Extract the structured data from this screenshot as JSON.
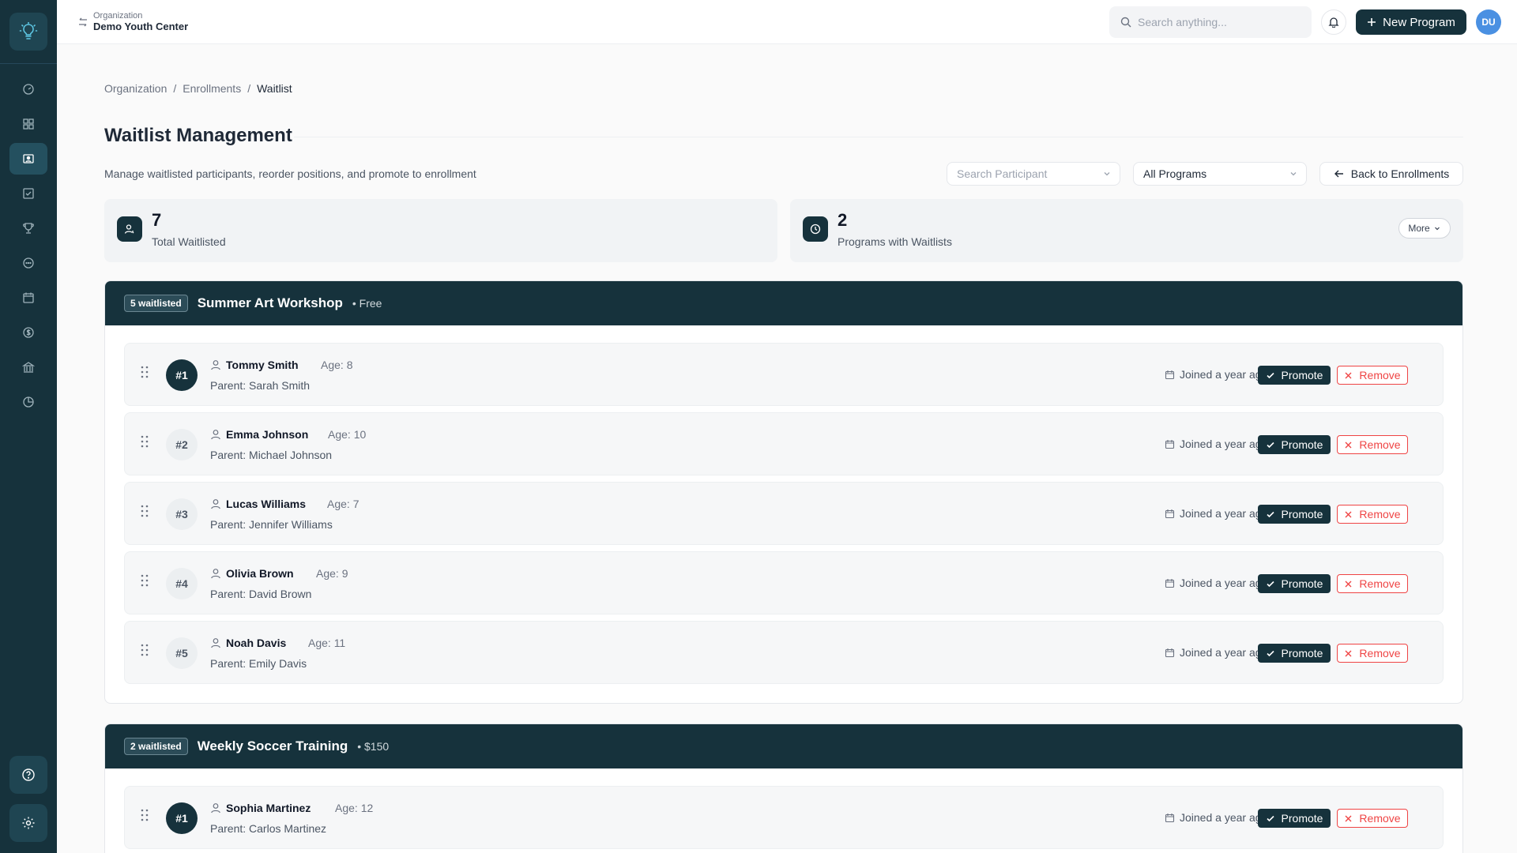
{
  "topbar": {
    "org_small": "Organization",
    "org_name": "Demo Youth Center",
    "search_placeholder": "Search anything...",
    "new_program_label": "New Program",
    "avatar_initials": "DU"
  },
  "sidebar": {
    "items": [
      "dashboard-icon",
      "grid-icon",
      "enrollments-icon",
      "check-square-icon",
      "trophy-icon",
      "chat-icon",
      "calendar-icon",
      "dollar-icon",
      "bank-icon",
      "pie-chart-icon"
    ],
    "active": "enrollments-icon",
    "bottom": [
      "help-icon",
      "settings-icon"
    ]
  },
  "breadcrumb": {
    "items": [
      "Organization",
      "Enrollments",
      "Waitlist"
    ],
    "separator": "/"
  },
  "page": {
    "title": "Waitlist Management",
    "subtitle": "Manage waitlisted participants, reorder positions, and promote to enrollment",
    "search_participant_placeholder": "Search Participant",
    "programs_select": "All Programs",
    "back_label": "Back to Enrollments"
  },
  "stats": [
    {
      "value": "7",
      "label": "Total Waitlisted"
    },
    {
      "value": "2",
      "label": "Programs with Waitlists",
      "more_label": "More"
    }
  ],
  "programs": [
    {
      "badge": "5 waitlisted",
      "name": "Summer Art Workshop",
      "price": "• Free",
      "entries": [
        {
          "pos": "#1",
          "name": "Tommy Smith",
          "age": "Age: 8",
          "parent": "Parent: Sarah Smith",
          "joined": "Joined a year ago"
        },
        {
          "pos": "#2",
          "name": "Emma Johnson",
          "age": "Age: 10",
          "parent": "Parent: Michael Johnson",
          "joined": "Joined a year ago"
        },
        {
          "pos": "#3",
          "name": "Lucas Williams",
          "age": "Age: 7",
          "parent": "Parent: Jennifer Williams",
          "joined": "Joined a year ago"
        },
        {
          "pos": "#4",
          "name": "Olivia Brown",
          "age": "Age: 9",
          "parent": "Parent: David Brown",
          "joined": "Joined a year ago"
        },
        {
          "pos": "#5",
          "name": "Noah Davis",
          "age": "Age: 11",
          "parent": "Parent: Emily Davis",
          "joined": "Joined a year ago"
        }
      ]
    },
    {
      "badge": "2 waitlisted",
      "name": "Weekly Soccer Training",
      "price": "• $150",
      "entries": [
        {
          "pos": "#1",
          "name": "Sophia Martinez",
          "age": "Age: 12",
          "parent": "Parent: Carlos Martinez",
          "joined": "Joined a year ago"
        }
      ]
    }
  ],
  "actions": {
    "promote": "Promote",
    "remove": "Remove"
  },
  "colors": {
    "primary": "#16323c",
    "danger": "#ef4444",
    "avatar": "#4a90e2"
  }
}
